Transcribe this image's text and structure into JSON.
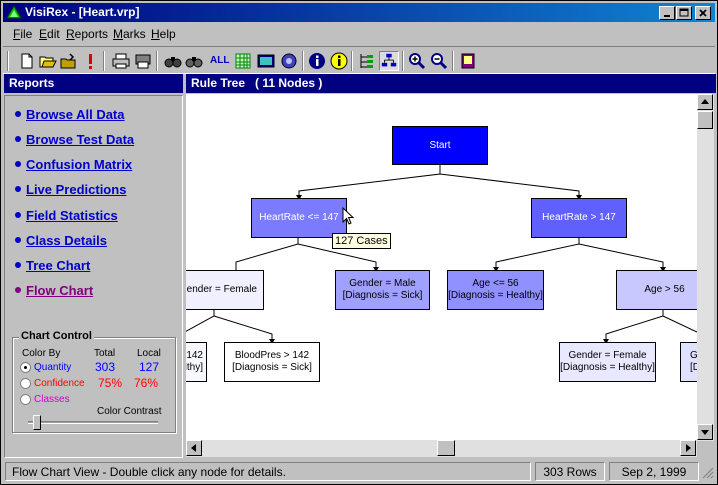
{
  "window": {
    "title": "VisiRex - [Heart.vrp]"
  },
  "menu": [
    {
      "label": "File",
      "mnemonic": "F",
      "rest": "ile"
    },
    {
      "label": "Edit",
      "mnemonic": "E",
      "rest": "dit"
    },
    {
      "label": "Reports",
      "mnemonic": "R",
      "rest": "eports"
    },
    {
      "label": "Marks",
      "mnemonic": "M",
      "rest": "arks"
    },
    {
      "label": "Help",
      "mnemonic": "H",
      "rest": "elp"
    }
  ],
  "toolbar": {
    "all_label": "ALL"
  },
  "reports_panel": {
    "title": "Reports",
    "links": [
      {
        "label": "Browse All Data"
      },
      {
        "label": "Browse Test Data"
      },
      {
        "label": "Confusion Matrix"
      },
      {
        "label": "Live Predictions"
      },
      {
        "label": "Field Statistics"
      },
      {
        "label": "Class Details"
      },
      {
        "label": "Tree Chart"
      },
      {
        "label": "Flow Chart"
      }
    ]
  },
  "chart_control": {
    "title": "Chart Control",
    "color_by": "Color By",
    "total": "Total",
    "local": "Local",
    "options": [
      {
        "label": "Quantity",
        "total": "303",
        "local": "127",
        "color": "#0000ff",
        "selected": true
      },
      {
        "label": "Confidence",
        "total": "75%",
        "local": "76%",
        "color": "#ff0000",
        "selected": false
      },
      {
        "label": "Classes",
        "color": "#cc00cc",
        "selected": false
      }
    ],
    "contrast_label": "Color Contrast",
    "contrast_level": 0.07
  },
  "tree_panel": {
    "header": "Rule Tree   ( 11 Nodes )",
    "nodes": {
      "start": {
        "line1": "Start",
        "color": "#0000ff",
        "text_color": "#ffffff"
      },
      "hr_low": {
        "line1": "HeartRate  <= 147",
        "color": "#7b7bff",
        "text_color": "#ffffff"
      },
      "hr_high": {
        "line1": "HeartRate  > 147",
        "color": "#6060ff",
        "text_color": "#ffffff"
      },
      "gender_female_left": {
        "line1": "Gender = Female",
        "color": "#f0f0ff",
        "text_color": "#000000"
      },
      "gender_male": {
        "line1": "Gender = Male",
        "line2": "[Diagnosis = Sick]",
        "color": "#a0a0ff",
        "text_color": "#000000"
      },
      "age_low": {
        "line1": "Age <= 56",
        "line2": "[Diagnosis = Healthy]",
        "color": "#9090ff",
        "text_color": "#000000"
      },
      "age_high": {
        "line1": "Age > 56",
        "color": "#c8c8ff",
        "text_color": "#000000"
      },
      "bp_low_leaf": {
        "line1": "142",
        "line2": "Healthy]",
        "color": "#f8f8ff",
        "text_color": "#000000"
      },
      "bp_high": {
        "line1": "BloodPres  > 142",
        "line2": "[Diagnosis = Sick]",
        "color": "#ffffff",
        "text_color": "#000000"
      },
      "gender_female_right": {
        "line1": "Gender = Female",
        "line2": "[Diagnosis = Healthy]",
        "color": "#e8e8ff",
        "text_color": "#000000"
      },
      "g_partial": {
        "line1": "G",
        "line2": "[D",
        "color": "#e0e0ff",
        "text_color": "#000000"
      }
    },
    "tooltip": "127 Cases"
  },
  "status": {
    "message": "Flow Chart View - Double click any node for details.",
    "rows": "303 Rows",
    "date": "Sep 2, 1999"
  }
}
